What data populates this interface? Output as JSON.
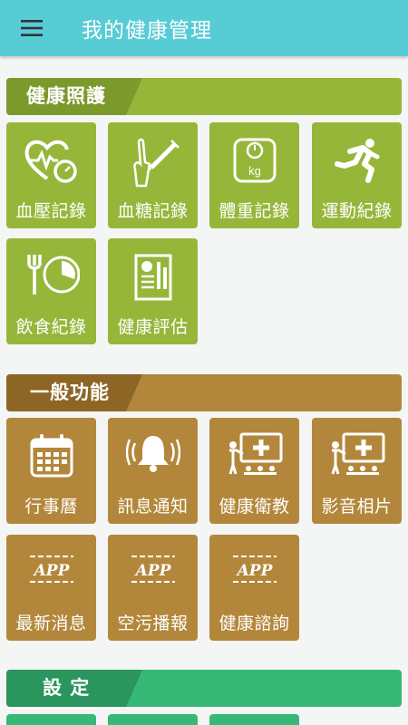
{
  "app": {
    "title": "我的健康管理",
    "menu_icon": "hamburger-menu-icon"
  },
  "colors": {
    "appbar": "#57ccd5",
    "health": "#96b63a",
    "general": "#b3873b",
    "settings": "#38b877"
  },
  "sections": {
    "health": {
      "title": "健康照護",
      "items": [
        {
          "label": "血壓記錄",
          "icon": "blood-pressure-heart-icon"
        },
        {
          "label": "血糖記錄",
          "icon": "blood-glucose-syringe-icon"
        },
        {
          "label": "體重記錄",
          "icon": "weight-scale-icon"
        },
        {
          "label": "運動紀錄",
          "icon": "running-person-icon"
        },
        {
          "label": "飲食紀錄",
          "icon": "fork-plate-icon"
        },
        {
          "label": "健康評估",
          "icon": "report-chart-icon"
        }
      ]
    },
    "general": {
      "title": "一般功能",
      "items": [
        {
          "label": "行事曆",
          "icon": "calendar-icon"
        },
        {
          "label": "訊息通知",
          "icon": "bell-ringing-icon"
        },
        {
          "label": "健康衛教",
          "icon": "teaching-board-icon"
        },
        {
          "label": "影音相片",
          "icon": "presentation-board-icon"
        },
        {
          "label": "最新消息",
          "icon": "app-badge-icon"
        },
        {
          "label": "空污播報",
          "icon": "app-badge-icon"
        },
        {
          "label": "健康諮詢",
          "icon": "app-badge-icon"
        }
      ]
    },
    "settings": {
      "title": "設 定"
    }
  }
}
